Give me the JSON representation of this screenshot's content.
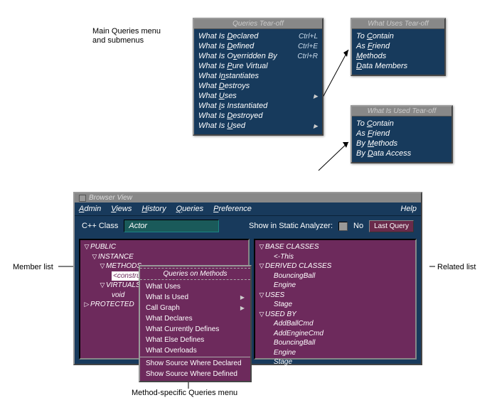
{
  "annotations": {
    "main_menu": "Main Queries menu\nand submenus",
    "member_list": "Member list",
    "related_list": "Related list",
    "method_menu": "Method-specific Queries menu"
  },
  "tearoffs": {
    "queries": {
      "title": "Queries Tear-off",
      "items": [
        {
          "label": "What Is Declared",
          "shortcut": "Ctrl+L"
        },
        {
          "label": "What Is Defined",
          "shortcut": "Ctrl+E"
        },
        {
          "label": "What Is Overridden By",
          "shortcut": "Ctrl+R"
        },
        {
          "label": "What Is Pure Virtual"
        },
        {
          "label": "What Instantiates"
        },
        {
          "label": "What Destroys"
        },
        {
          "label": "What Uses",
          "sub": true
        },
        {
          "label": "What Is Instantiated"
        },
        {
          "label": "What Is Destroyed"
        },
        {
          "label": "What Is Used",
          "sub": true
        }
      ]
    },
    "what_uses": {
      "title": "What Uses Tear-off",
      "items": [
        "To Contain",
        "As Friend",
        "Methods",
        "Data Members"
      ]
    },
    "what_is_used": {
      "title": "What Is Used Tear-off",
      "items": [
        "To Contain",
        "As Friend",
        "By Methods",
        "By Data Access"
      ]
    }
  },
  "browser": {
    "title": "Browser View",
    "menubar": [
      "Admin",
      "Views",
      "History",
      "Queries",
      "Preference"
    ],
    "help": "Help",
    "type_label": "C++ Class",
    "class_value": "Actor",
    "static_label": "Show in Static Analyzer:",
    "no_label": "No",
    "last_query": "Last Query"
  },
  "member_tree": {
    "root": "PUBLIC",
    "instance": "INSTANCE",
    "methods": "METHODS",
    "constructor": "<constructor> Actor (Stage*);",
    "virtuals": "VIRTUALS",
    "void_line": "void",
    "protected": "PROTECTED"
  },
  "related_tree": {
    "base": "BASE CLASSES",
    "this": "<-This",
    "derived": "DERIVED CLASSES",
    "derived_items": [
      "BouncingBall",
      "Engine"
    ],
    "uses": "USES",
    "uses_items": [
      "Stage"
    ],
    "usedby": "USED BY",
    "usedby_items": [
      "AddBallCmd",
      "AddEngineCmd",
      "BouncingBall",
      "Engine",
      "Stage"
    ]
  },
  "context_menu": {
    "title": "Queries on Methods",
    "items": [
      {
        "label": "What Uses"
      },
      {
        "label": "What Is Used",
        "sub": true
      },
      {
        "label": "Call Graph",
        "sub": true
      },
      {
        "label": "What Declares"
      },
      {
        "label": "What Currently Defines"
      },
      {
        "label": "What Else Defines"
      },
      {
        "label": "What Overloads"
      },
      {
        "sep": true
      },
      {
        "label": "Show Source Where Declared"
      },
      {
        "label": "Show Source Where Defined"
      }
    ]
  }
}
